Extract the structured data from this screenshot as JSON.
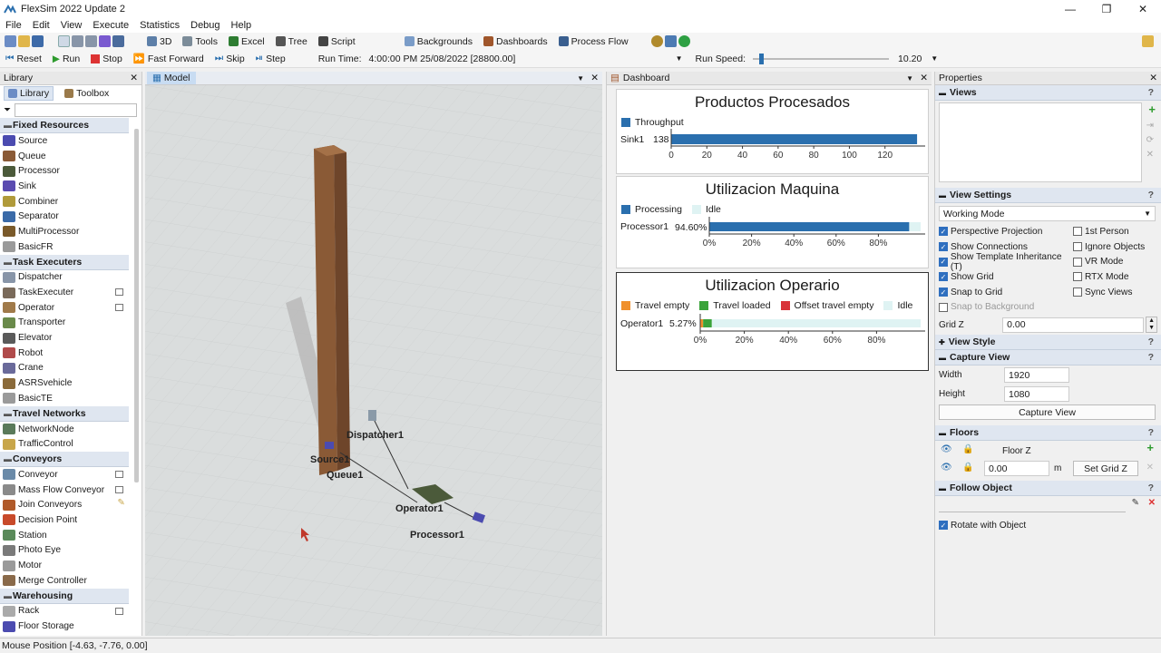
{
  "window": {
    "title": "FlexSim 2022 Update 2",
    "minimize": "—",
    "maximize": "❐",
    "close": "✕"
  },
  "menu": [
    "File",
    "Edit",
    "View",
    "Execute",
    "Statistics",
    "Debug",
    "Help"
  ],
  "toolbar": {
    "btn3d": "3D",
    "tools": "Tools",
    "excel": "Excel",
    "tree": "Tree",
    "script": "Script",
    "backgrounds": "Backgrounds",
    "dashboards": "Dashboards",
    "process_flow": "Process Flow"
  },
  "runbar": {
    "reset": "Reset",
    "run": "Run",
    "stop": "Stop",
    "fast_forward": "Fast Forward",
    "skip": "Skip",
    "step": "Step",
    "run_time_label": "Run Time:",
    "run_time_value": "4:00:00 PM  25/08/2022  [28800.00]",
    "run_speed_label": "Run Speed:",
    "run_speed_value": "10.20",
    "run_speed_level": 0.05
  },
  "library": {
    "title": "Library",
    "close": "✕",
    "tab_library": "Library",
    "tab_toolbox": "Toolbox",
    "sections": [
      {
        "name": "Fixed Resources",
        "items": [
          "Source",
          "Queue",
          "Processor",
          "Sink",
          "Combiner",
          "Separator",
          "MultiProcessor",
          "BasicFR"
        ]
      },
      {
        "name": "Task Executers",
        "items": [
          "Dispatcher",
          "TaskExecuter",
          "Operator",
          "Transporter",
          "Elevator",
          "Robot",
          "Crane",
          "ASRSvehicle",
          "BasicTE"
        ]
      },
      {
        "name": "Travel Networks",
        "items": [
          "NetworkNode",
          "TrafficControl"
        ]
      },
      {
        "name": "Conveyors",
        "items": [
          "Conveyor",
          "Mass Flow Conveyor",
          "Join Conveyors",
          "Decision Point",
          "Station",
          "Photo Eye",
          "Motor",
          "Merge Controller"
        ]
      },
      {
        "name": "Warehousing",
        "items": [
          "Rack",
          "Floor Storage"
        ]
      }
    ]
  },
  "model": {
    "tab": "Model",
    "labels": {
      "dispatcher": "Dispatcher1",
      "source": "Source1",
      "queue": "Queue1",
      "operator": "Operator1",
      "processor": "Processor1"
    }
  },
  "dashboard": {
    "tab": "Dashboard",
    "widgets": [
      {
        "title": "Productos Procesados",
        "legend": [
          {
            "name": "Throughput",
            "color": "#2a6fae"
          }
        ],
        "row": "Sink1",
        "value_label": "138",
        "axis": [
          "0",
          "20",
          "40",
          "60",
          "80",
          "100",
          "120"
        ]
      },
      {
        "title": "Utilizacion Maquina",
        "legend": [
          {
            "name": "Processing",
            "color": "#2a6fae"
          },
          {
            "name": "Idle",
            "color": "#dff3f3"
          }
        ],
        "row": "Processor1",
        "value_label": "94.60%",
        "axis": [
          "0%",
          "20%",
          "40%",
          "60%",
          "80%"
        ]
      },
      {
        "title": "Utilizacion Operario",
        "legend": [
          {
            "name": "Travel empty",
            "color": "#f0902c"
          },
          {
            "name": "Travel loaded",
            "color": "#3aa33a"
          },
          {
            "name": "Offset travel empty",
            "color": "#d8343a"
          },
          {
            "name": "Idle",
            "color": "#dff3f3"
          }
        ],
        "row": "Operator1",
        "value_label": "5.27%",
        "axis": [
          "0%",
          "20%",
          "40%",
          "60%",
          "80%"
        ]
      }
    ]
  },
  "chart_data": [
    {
      "type": "bar",
      "title": "Productos Procesados",
      "categories": [
        "Sink1"
      ],
      "series": [
        {
          "name": "Throughput",
          "values": [
            138
          ]
        }
      ],
      "xlim": [
        0,
        140
      ]
    },
    {
      "type": "bar",
      "title": "Utilizacion Maquina",
      "categories": [
        "Processor1"
      ],
      "series": [
        {
          "name": "Processing",
          "values": [
            94.6
          ]
        },
        {
          "name": "Idle",
          "values": [
            5.4
          ]
        }
      ],
      "xlim": [
        0,
        100
      ]
    },
    {
      "type": "bar",
      "title": "Utilizacion Operario",
      "categories": [
        "Operator1"
      ],
      "series": [
        {
          "name": "Travel empty",
          "values": [
            1.3
          ]
        },
        {
          "name": "Travel loaded",
          "values": [
            3.97
          ]
        },
        {
          "name": "Offset travel empty",
          "values": [
            0
          ]
        },
        {
          "name": "Idle",
          "values": [
            94.73
          ]
        }
      ],
      "xlim": [
        0,
        100
      ]
    }
  ],
  "properties": {
    "title": "Properties",
    "close": "✕",
    "q": "?",
    "views": "Views",
    "view_settings": "View Settings",
    "working_mode": "Working Mode",
    "checks_left": [
      {
        "label": "Perspective Projection",
        "on": true
      },
      {
        "label": "Show Connections",
        "on": true
      },
      {
        "label": "Show Template Inheritance (T)",
        "on": true
      },
      {
        "label": "Show Grid",
        "on": true
      },
      {
        "label": "Snap to Grid",
        "on": true
      },
      {
        "label": "Snap to Background",
        "on": false
      }
    ],
    "checks_right": [
      {
        "label": "1st Person",
        "on": false
      },
      {
        "label": "Ignore Objects",
        "on": false
      },
      {
        "label": "VR Mode",
        "on": false
      },
      {
        "label": "RTX Mode",
        "on": false
      },
      {
        "label": "Sync Views",
        "on": false
      }
    ],
    "grid_z_label": "Grid Z",
    "grid_z_value": "0.00",
    "view_style": "View Style",
    "capture_view": "Capture View",
    "width_label": "Width",
    "width_value": "1920",
    "height_label": "Height",
    "height_value": "1080",
    "capture_button": "Capture View",
    "floors": "Floors",
    "floor_z": "Floor Z",
    "floor_value": "0.00",
    "floor_unit": "m",
    "set_grid_z": "Set Grid Z",
    "follow_object": "Follow Object",
    "rotate_with_object": "Rotate with Object"
  },
  "status": {
    "mouse_position": "Mouse Position [-4.63, -7.76, 0.00]"
  }
}
